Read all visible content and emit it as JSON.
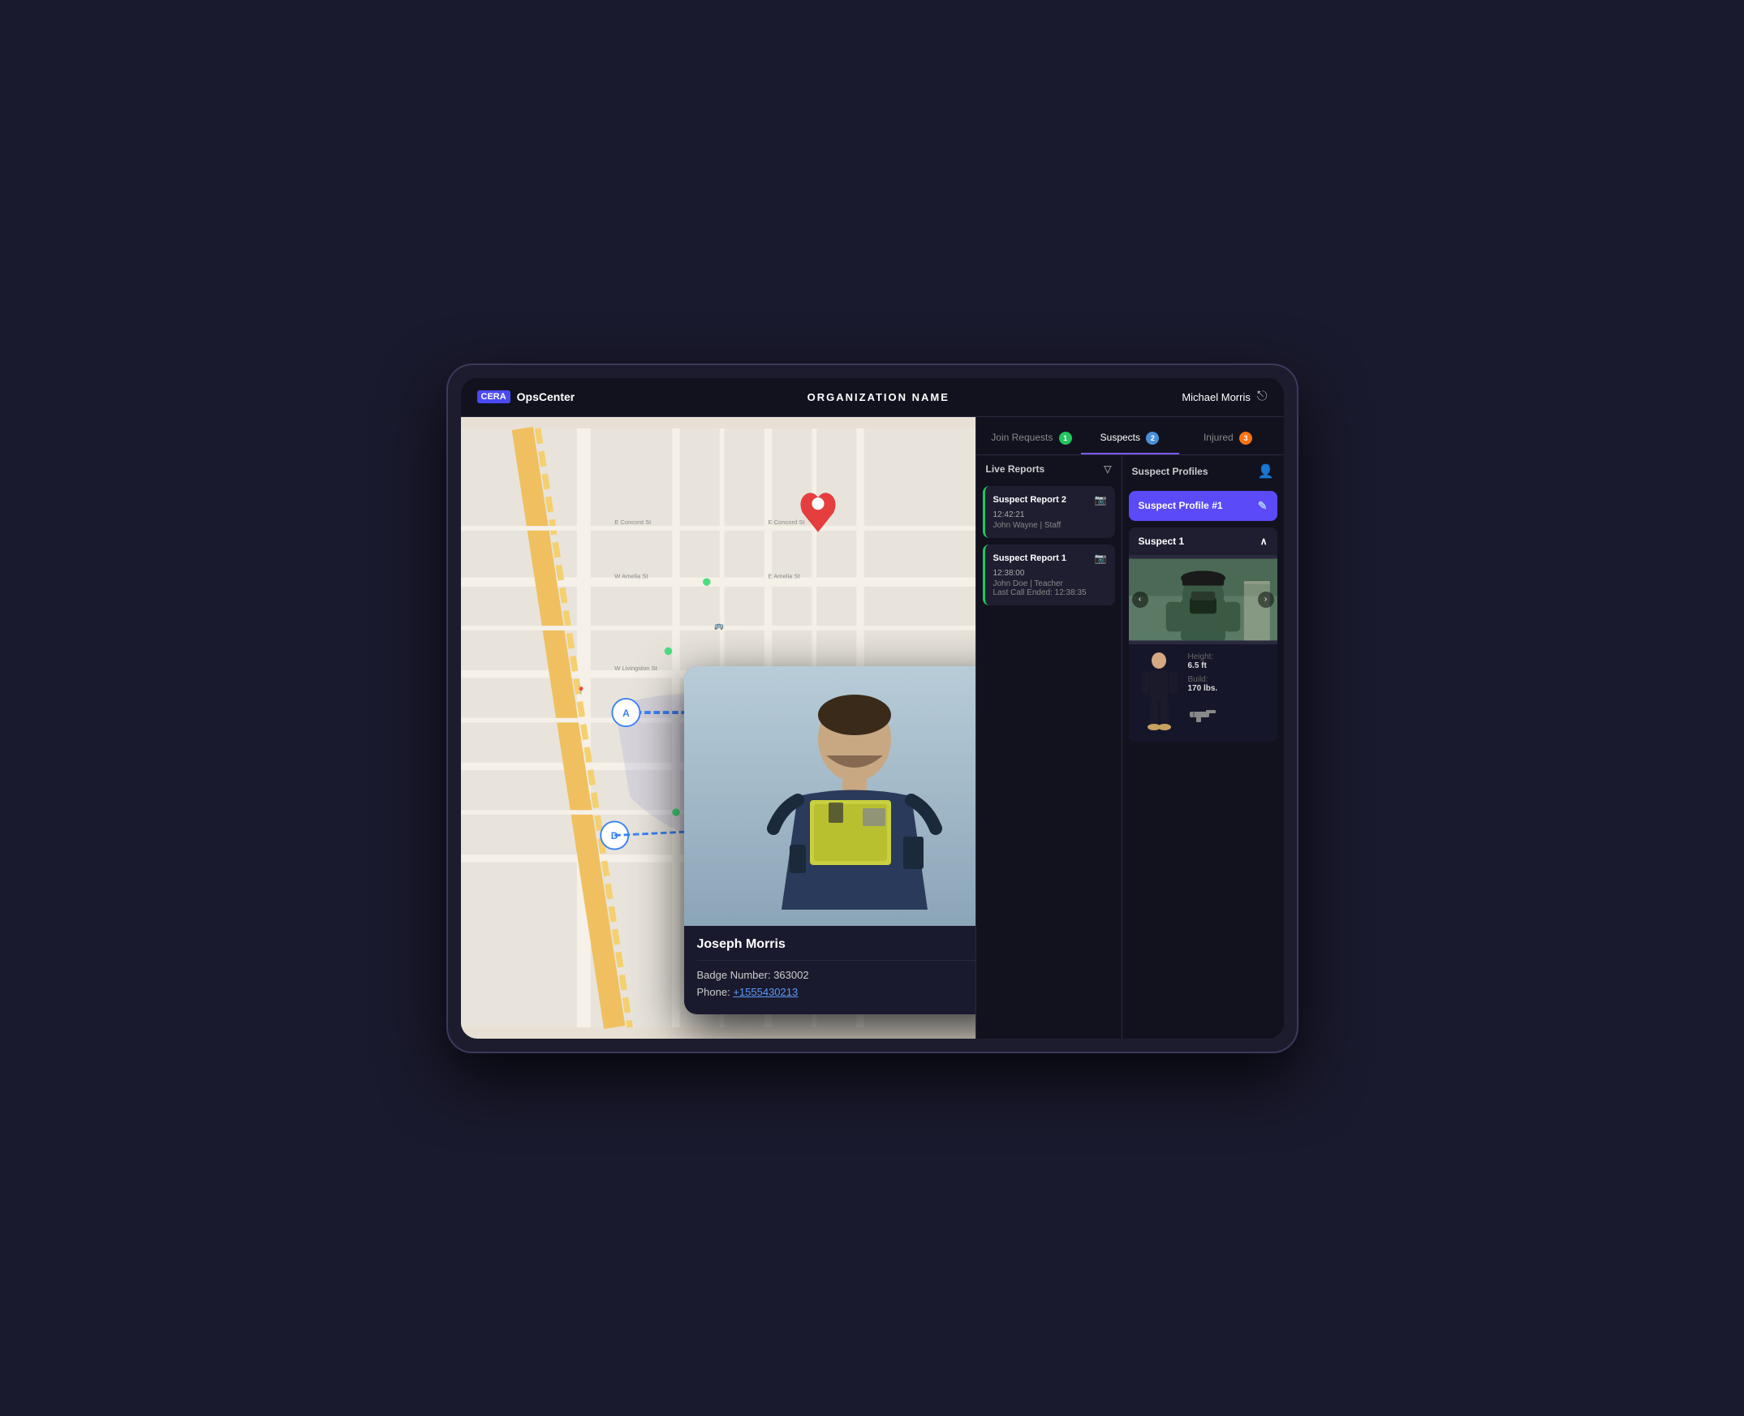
{
  "app": {
    "logo_text": "CERA",
    "app_name": "OpsCenter",
    "org_name": "ORGANIZATION NAME",
    "user_name": "Michael Morris"
  },
  "tabs": [
    {
      "id": "join-requests",
      "label": "Join Requests",
      "badge": "1",
      "badge_color": "green",
      "active": false
    },
    {
      "id": "suspects",
      "label": "Suspects",
      "badge": "2",
      "badge_color": "blue",
      "active": true
    },
    {
      "id": "injured",
      "label": "Injured",
      "badge": "3",
      "badge_color": "orange",
      "active": false
    }
  ],
  "live_reports": {
    "header": "Live Reports",
    "reports": [
      {
        "id": "report2",
        "title": "Suspect Report 2",
        "time": "12:42:21",
        "person": "John Wayne",
        "role": "Staff",
        "has_video": true
      },
      {
        "id": "report1",
        "title": "Suspect Report 1",
        "time": "12:38:00",
        "person": "John Doe",
        "role": "Teacher",
        "last_call": "Last Call Ended: 12:38:35",
        "has_video": true
      }
    ]
  },
  "suspect_profiles": {
    "header": "Suspect Profiles",
    "active_profile": "Suspect Profile #1",
    "suspects": [
      {
        "id": "suspect1",
        "name": "Suspect 1",
        "expanded": true,
        "height": "6.5 ft",
        "build": "170 lbs.",
        "has_weapon": true
      }
    ]
  },
  "officer_popup": {
    "name": "Joseph Morris",
    "badge_label": "Badge Number:",
    "badge_number": "363002",
    "phone_label": "Phone:",
    "phone": "+1555430213"
  },
  "icons": {
    "logout": "→",
    "filter": "▼",
    "add_person": "👤+",
    "edit": "✎",
    "chevron_down": "∨",
    "chevron_up": "∧",
    "video": "📹",
    "arrow_right": "›",
    "arrow_left": "‹"
  }
}
